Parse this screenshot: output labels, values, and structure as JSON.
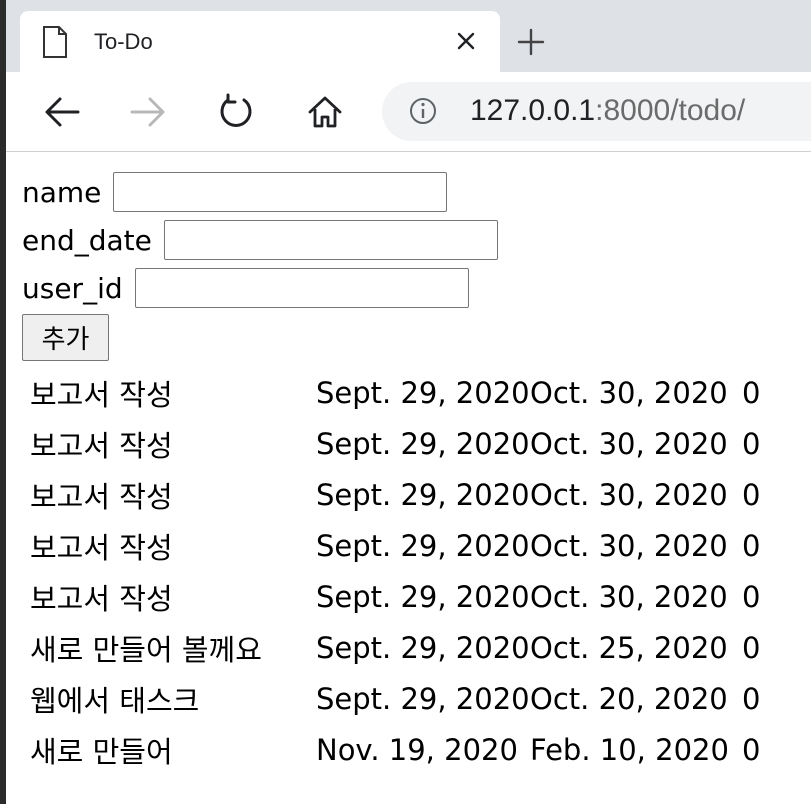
{
  "browser": {
    "tab_title": "To-Do",
    "url_host": "127.0.0.1",
    "url_path": ":8000/todo/"
  },
  "form": {
    "name_label": "name",
    "end_date_label": "end_date",
    "user_id_label": "user_id",
    "name_value": "",
    "end_date_value": "",
    "user_id_value": "",
    "submit_label": "추가"
  },
  "todos": [
    {
      "name": "보고서 작성",
      "start": "Sept. 29, 2020",
      "end": "Oct. 30, 2020",
      "user": "0"
    },
    {
      "name": "보고서 작성",
      "start": "Sept. 29, 2020",
      "end": "Oct. 30, 2020",
      "user": "0"
    },
    {
      "name": "보고서 작성",
      "start": "Sept. 29, 2020",
      "end": "Oct. 30, 2020",
      "user": "0"
    },
    {
      "name": "보고서 작성",
      "start": "Sept. 29, 2020",
      "end": "Oct. 30, 2020",
      "user": "0"
    },
    {
      "name": "보고서 작성",
      "start": "Sept. 29, 2020",
      "end": "Oct. 30, 2020",
      "user": "0"
    },
    {
      "name": "새로 만들어 볼께요",
      "start": "Sept. 29, 2020",
      "end": "Oct. 25, 2020",
      "user": "0"
    },
    {
      "name": "웹에서 태스크",
      "start": "Sept. 29, 2020",
      "end": "Oct. 20, 2020",
      "user": "0"
    },
    {
      "name": "새로 만들어",
      "start": "Nov. 19, 2020",
      "end": "Feb. 10, 2020",
      "user": "0"
    }
  ]
}
